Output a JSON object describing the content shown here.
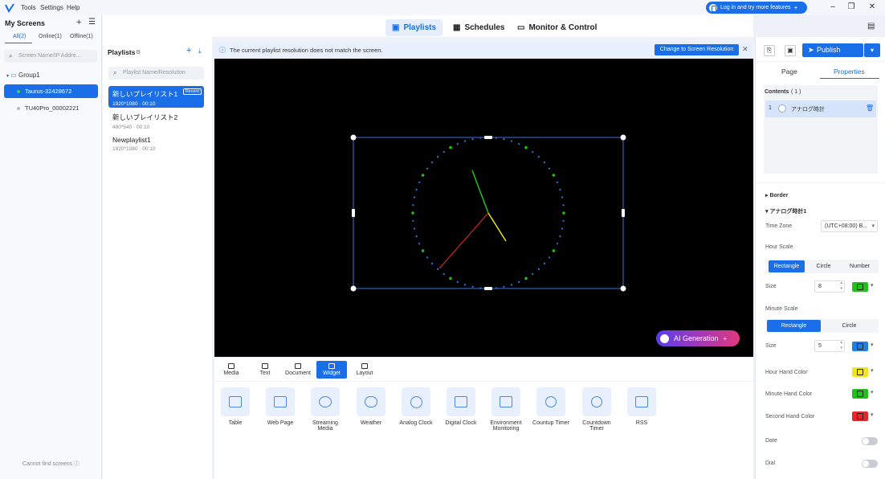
{
  "menu": {
    "tools": "Tools",
    "settings": "Settings",
    "help": "Help"
  },
  "login_button": "Log in and try more features",
  "left": {
    "title": "My Screens",
    "tabs": [
      "All(2)",
      "Online(1)",
      "Offline(1)"
    ],
    "search_placeholder": "Screen Name/IP Addre...",
    "group": "Group1",
    "screens": [
      {
        "name": "Taurus-32428672",
        "status": "online"
      },
      {
        "name": "TU40Pro_00002221",
        "status": "offline"
      }
    ],
    "footer": "Cannot find screens"
  },
  "nav": {
    "playlists": "Playlists",
    "schedules": "Schedules",
    "monitor": "Monitor & Control"
  },
  "playlists": {
    "title": "Playlists",
    "search_placeholder": "Playlist Name/Resolution",
    "items": [
      {
        "name": "新しいプレイリスト1",
        "meta": "1920*1080 · 00:10",
        "badge": "Recent"
      },
      {
        "name": "新しいプレイリスト2",
        "meta": "480*540 · 00:10"
      },
      {
        "name": "Newplaylist1",
        "meta": "1920*1080 · 00:10"
      }
    ]
  },
  "banner": {
    "text": "The current playlist resolution does not match the screen.",
    "button": "Change to Screen Resolution"
  },
  "ai_button": "AI Generation",
  "toolbar_tabs": [
    "Media",
    "Text",
    "Document",
    "Widget",
    "Layout"
  ],
  "widgets": [
    "Table",
    "Web Page",
    "Streaming Media",
    "Weather",
    "Analog Clock",
    "Digital Clock",
    "Environment Monitoring",
    "Countup Timer",
    "Countdown Timer",
    "RSS"
  ],
  "right": {
    "publish": "Publish",
    "tabs": [
      "Page",
      "Properties"
    ],
    "contents_label": "Contents",
    "contents_count": "( 1 )",
    "content_item": {
      "index": "1",
      "name": "アナログ時計"
    },
    "border": "Border",
    "section": "アナログ時計1",
    "time_zone_label": "Time Zone",
    "time_zone_value": "(UTC+08:00) B...",
    "hour_scale_label": "Hour Scale",
    "hour_scale_options": [
      "Rectangle",
      "Circle",
      "Number"
    ],
    "hour_size_label": "Size",
    "hour_size": "8",
    "minute_scale_label": "Minute Scale",
    "minute_scale_options": [
      "Rectangle",
      "Circle"
    ],
    "minute_size_label": "Size",
    "minute_size": "5",
    "hour_hand_label": "Hour Hand Color",
    "minute_hand_label": "Minute Hand Color",
    "second_hand_label": "Second Hand Color",
    "date_label": "Date",
    "dial_label": "Dial"
  },
  "colors": {
    "accent": "#1a6fe8",
    "hour_scale": "#22c11a",
    "minute_scale": "#1e7fe6",
    "hour_hand": "#f2e51c",
    "minute_hand": "#22c11a",
    "second_hand": "#e8262c"
  }
}
